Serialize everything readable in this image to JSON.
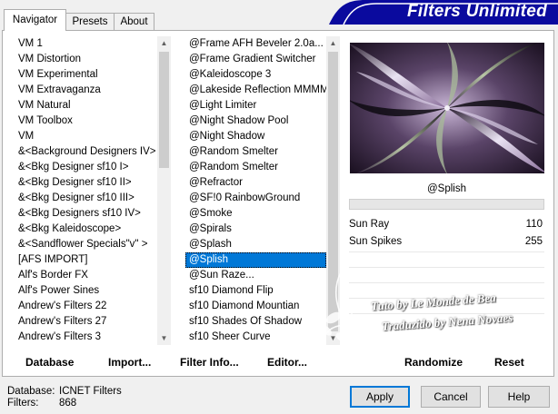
{
  "tabs": [
    {
      "label": "Navigator"
    },
    {
      "label": "Presets"
    },
    {
      "label": "About"
    }
  ],
  "banner": {
    "title": "Filters Unlimited"
  },
  "categories": {
    "items": [
      "VM 1",
      "VM Distortion",
      "VM Experimental",
      "VM Extravaganza",
      "VM Natural",
      "VM Toolbox",
      "VM",
      "&<Background Designers IV>",
      "&<Bkg Designer sf10 I>",
      "&<Bkg Designer sf10 II>",
      "&<Bkg Designer sf10 III>",
      "&<Bkg Designers sf10 IV>",
      "&<Bkg Kaleidoscope>",
      "&<Sandflower Specials\"v\" >",
      "[AFS IMPORT]",
      "Alf's Border FX",
      "Alf's Power Sines",
      "Andrew's Filters 22",
      "Andrew's Filters 27",
      "Andrew's Filters 3"
    ]
  },
  "filters": {
    "items": [
      "@Frame AFH Beveler 2.0a...",
      "@Frame Gradient Switcher",
      "@Kaleidoscope 3",
      "@Lakeside Reflection MMMM",
      "@Light Limiter",
      "@Night Shadow Pool",
      "@Night Shadow",
      "@Random Smelter",
      "@Random Smelter",
      "@Refractor",
      "@SF!0 RainbowGround",
      "@Smoke",
      "@Spirals",
      "@Splash",
      "@Splish",
      "@Sun Raze...",
      "sf10 Diamond Flip",
      "sf10 Diamond Mountian",
      "sf10 Shades Of Shadow",
      "sf10 Sheer Curve"
    ],
    "selected_index": 14
  },
  "filter_name": "@Splish",
  "params": [
    {
      "label": "Sun Ray",
      "value": "110"
    },
    {
      "label": "Sun Spikes",
      "value": "255"
    }
  ],
  "buttons": {
    "database": "Database",
    "import": "Import...",
    "filter_info": "Filter Info...",
    "editor": "Editor...",
    "randomize": "Randomize",
    "reset": "Reset",
    "apply": "Apply",
    "cancel": "Cancel",
    "help": "Help"
  },
  "info": {
    "database_label": "Database:",
    "database_value": "ICNET Filters",
    "filters_label": "Filters:",
    "filters_value": "868"
  },
  "watermark": {
    "line1": "Tuto by Le Monde de Bea",
    "line2": "Traduzido by Nena Novaes"
  },
  "colors": {
    "accent": "#0078d7",
    "banner": "#0a0a9e",
    "preview_purple": "#8a6e9a",
    "preview_light": "#e6dff0",
    "preview_green": "#a8b89a"
  }
}
